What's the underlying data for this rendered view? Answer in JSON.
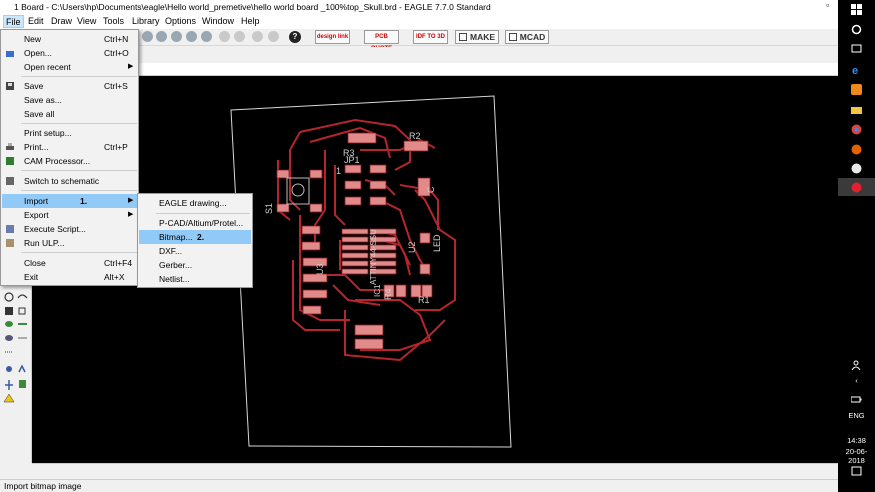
{
  "window": {
    "title": "1 Board - C:\\Users\\hp\\Documents\\eagle\\Hello world_premetive\\hello world board _100%top_Skull.brd - EAGLE 7.7.0 Standard"
  },
  "menubar": [
    "File",
    "Edit",
    "Draw",
    "View",
    "Tools",
    "Library",
    "Options",
    "Window",
    "Help"
  ],
  "toolbar": {
    "buttons": [
      {
        "name": "design-link-button",
        "label": "design link"
      },
      {
        "name": "pcb-quote-button",
        "label": "PCB QUOTE"
      },
      {
        "name": "idf-button",
        "label": "IDF TO 3D"
      },
      {
        "name": "make-button",
        "label": "MAKE"
      },
      {
        "name": "mcad-button",
        "label": "MCAD"
      }
    ],
    "help_label": "?"
  },
  "file_menu": {
    "items": [
      {
        "label": "New",
        "shortcut": "Ctrl+N"
      },
      {
        "label": "Open...",
        "shortcut": "Ctrl+O"
      },
      {
        "label": "Open recent",
        "submenu": true
      },
      {
        "label": "Save",
        "shortcut": "Ctrl+S"
      },
      {
        "label": "Save as..."
      },
      {
        "label": "Save all"
      },
      {
        "label": "Print setup..."
      },
      {
        "label": "Print...",
        "shortcut": "Ctrl+P"
      },
      {
        "label": "CAM Processor..."
      },
      {
        "label": "Switch to schematic"
      },
      {
        "label": "Import",
        "submenu": true,
        "highlighted": true,
        "annotation": "1."
      },
      {
        "label": "Export",
        "submenu": true
      },
      {
        "label": "Execute Script..."
      },
      {
        "label": "Run ULP..."
      },
      {
        "label": "Close",
        "shortcut": "Ctrl+F4"
      },
      {
        "label": "Exit",
        "shortcut": "Alt+X"
      }
    ]
  },
  "import_submenu": {
    "items": [
      {
        "label": "EAGLE drawing..."
      },
      {
        "label": "P-CAD/Altium/Protel..."
      },
      {
        "label": "Bitmap...",
        "highlighted": true,
        "annotation": "2."
      },
      {
        "label": "DXF..."
      },
      {
        "label": "Gerber..."
      },
      {
        "label": "Netlist..."
      }
    ]
  },
  "board_labels": {
    "r2": "R2",
    "r3": "R3",
    "jp1": "JP1",
    "s1": "S1",
    "one": "1",
    "ic": "ATTINY44-SSU",
    "ic_ref": "IC1",
    "u2": "U2",
    "led": "LED",
    "c": "C",
    "r4": "R4",
    "r1": "R1",
    "u3": "U3"
  },
  "status": {
    "text": "Import bitmap image"
  },
  "taskbar": {
    "time": "14:38",
    "date": "20-06-2018",
    "lang": "ENG"
  },
  "colors": {
    "trace": "#b5262c",
    "pad": "#e08a8a",
    "canvas": "#000000",
    "highlight": "#91c9f7"
  }
}
